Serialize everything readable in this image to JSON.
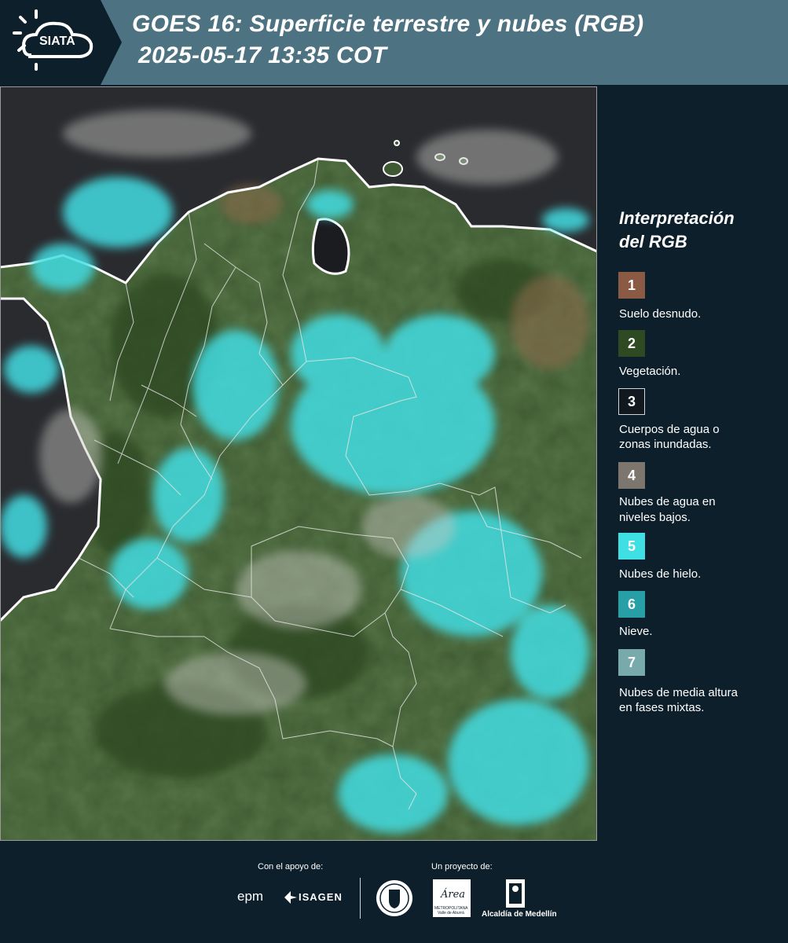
{
  "header": {
    "logo_text": "SIATA",
    "title_line1": "GOES 16: Superficie terrestre y nubes (RGB)",
    "title_line2": "2025-05-17 13:35 COT"
  },
  "legend": {
    "title_line1": "Interpretación",
    "title_line2": "del RGB",
    "items": [
      {
        "number": "1",
        "label": "Suelo desnudo.",
        "color": "#8a5a45"
      },
      {
        "number": "2",
        "label": "Vegetación.",
        "color": "#2d4a22"
      },
      {
        "number": "3",
        "label_line1": "Cuerpos de agua o",
        "label_line2": "zonas inundadas.",
        "color": "#111820"
      },
      {
        "number": "4",
        "label_line1": "Nubes de agua en",
        "label_line2": "niveles bajos.",
        "color": "#7d766e"
      },
      {
        "number": "5",
        "label": "Nubes de hielo.",
        "color": "#3fe0e4"
      },
      {
        "number": "6",
        "label": "Nieve.",
        "color": "#26a0a6"
      },
      {
        "number": "7",
        "label_line1": "Nubes de media altura",
        "label_line2": "en fases mixtas.",
        "color": "#78a9ab"
      }
    ]
  },
  "footer": {
    "support_caption": "Con el apoyo de:",
    "project_caption": "Un proyecto de:",
    "epm_text": "epm",
    "isagen_text": "ISAGEN",
    "area_text": "Área",
    "area_sub1": "METROPOLITANA",
    "area_sub2": "Valle de Aburrá",
    "alcaldia_text": "Alcaldía de Medellín"
  }
}
